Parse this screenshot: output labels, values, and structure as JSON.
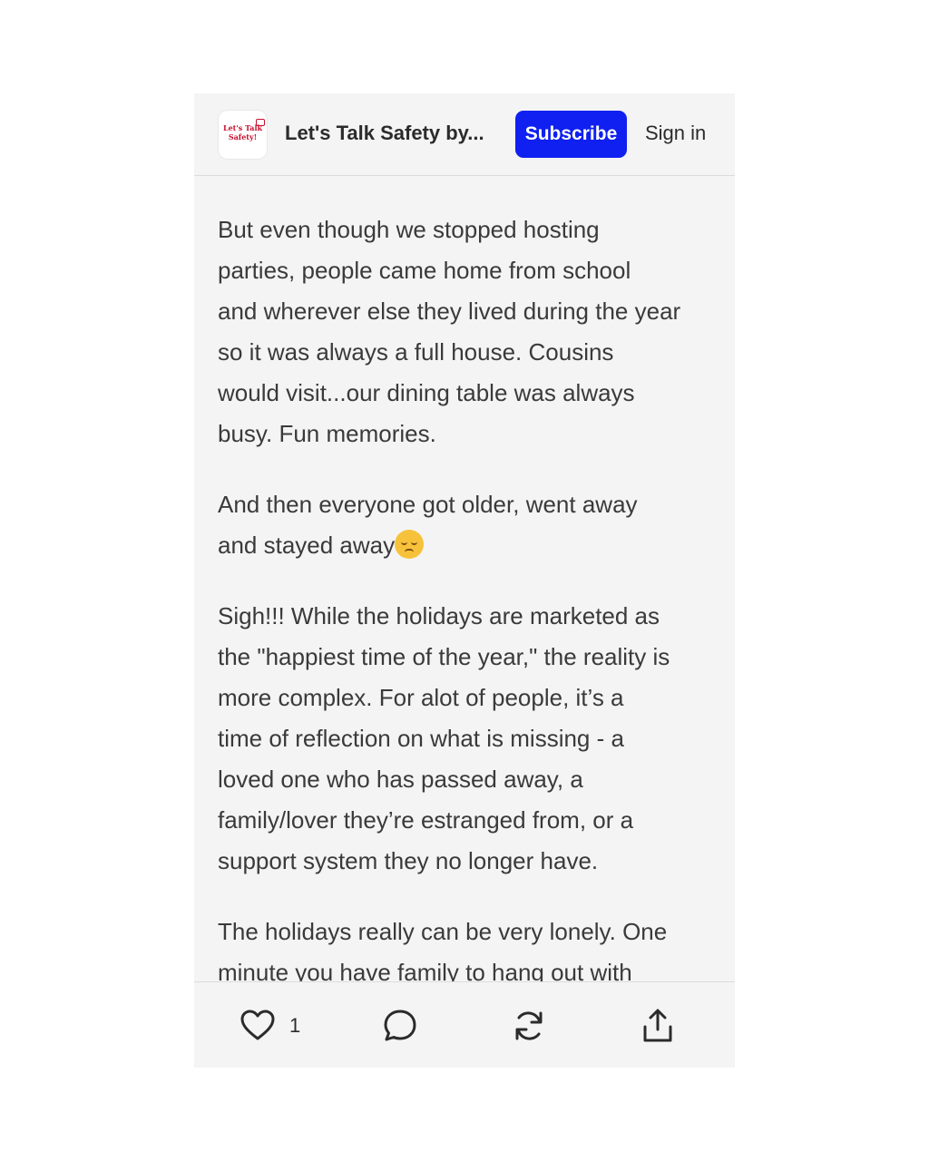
{
  "header": {
    "logo_text": "Let's Talk\nSafety!",
    "title": "Let's Talk Safety by...",
    "subscribe_label": "Subscribe",
    "signin_label": "Sign in"
  },
  "article": {
    "paragraphs": [
      "But even though we stopped hosting\nparties, people came home from school\nand wherever else they lived during the year\nso it was always a full house. Cousins\nwould visit...our dining table was always\nbusy. Fun memories.",
      "And then everyone got older, went away\nand stayed away",
      "Sigh!!! While the holidays are marketed as\nthe \"happiest time of the year,\" the reality is\nmore complex. For alot of people, it’s a\ntime of reflection on what is missing - a\nloved one who has passed away, a\nfamily/lover they’re estranged from, or a\nsupport system they no longer have.",
      "The holidays really can be very lonely. One\nminute you have family to hang out with"
    ],
    "emoji": "pensive-face"
  },
  "actions": {
    "like_count": "1",
    "icons": [
      "heart-icon",
      "comment-icon",
      "restack-icon",
      "share-icon"
    ]
  },
  "colors": {
    "accent": "#0f20f0",
    "background": "#f4f4f4",
    "text": "#3a3a3a",
    "logo_red": "#c8102e"
  }
}
